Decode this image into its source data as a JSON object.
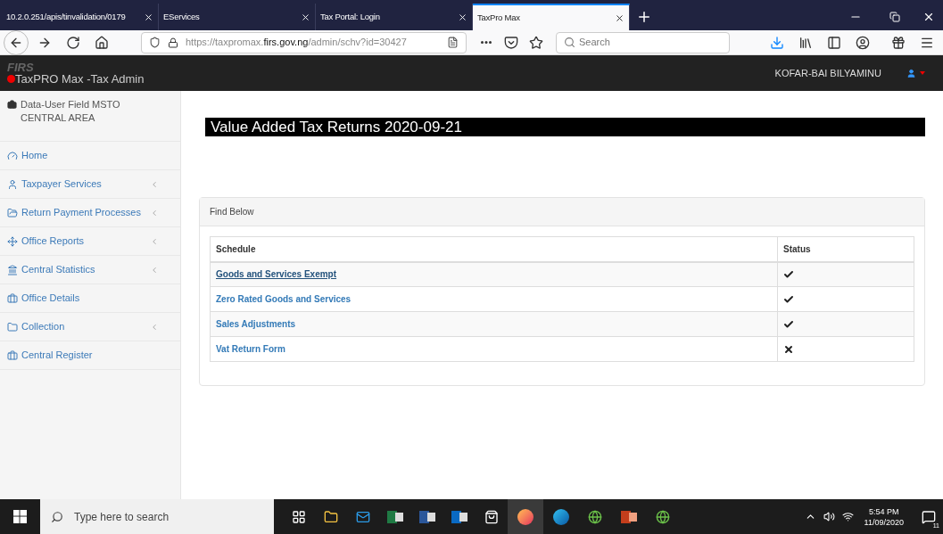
{
  "browser": {
    "tabs": [
      {
        "label": "10.2.0.251/apis/tinvalidation/0179",
        "selected": false
      },
      {
        "label": "EServices",
        "selected": false
      },
      {
        "label": "Tax Portal: Login",
        "selected": false
      },
      {
        "label": "TaxPro Max",
        "selected": true
      }
    ],
    "url": {
      "host_prefix": "https://taxpromax.",
      "host_main": "firs.gov.ng",
      "path": "/admin/schv?id=30427"
    },
    "search": {
      "placeholder": "Search"
    }
  },
  "header": {
    "logo": "FIRS",
    "app_name": "TaxPRO Max -Tax Admin",
    "user": "KOFAR-BAI BILYAMINU"
  },
  "sidebar": {
    "office": "Data-User Field MSTO CENTRAL AREA",
    "items": [
      {
        "label": "Home",
        "has_submenu": false
      },
      {
        "label": "Taxpayer Services",
        "has_submenu": true
      },
      {
        "label": "Return Payment Processes",
        "has_submenu": true
      },
      {
        "label": "Office Reports",
        "has_submenu": true
      },
      {
        "label": "Central Statistics",
        "has_submenu": true
      },
      {
        "label": "Office Details",
        "has_submenu": false
      },
      {
        "label": "Collection",
        "has_submenu": true
      },
      {
        "label": "Central Register",
        "has_submenu": false
      }
    ]
  },
  "page_title": "Value Added Tax Returns 2020-09-21",
  "panel": {
    "heading": "Find Below",
    "table": {
      "columns": [
        "Schedule",
        "Status"
      ],
      "rows": [
        {
          "schedule": "Goods and Services Exempt",
          "filed": true,
          "hovered": true
        },
        {
          "schedule": "Zero Rated Goods and Services",
          "filed": true,
          "hovered": false
        },
        {
          "schedule": "Sales Adjustments",
          "filed": true,
          "hovered": false
        },
        {
          "schedule": "Vat Return Form",
          "filed": false,
          "hovered": false
        }
      ]
    }
  },
  "taskbar": {
    "search_placeholder": "Type here to search",
    "time": "5:54 PM",
    "date": "11/09/2020",
    "notification_count": "11"
  }
}
